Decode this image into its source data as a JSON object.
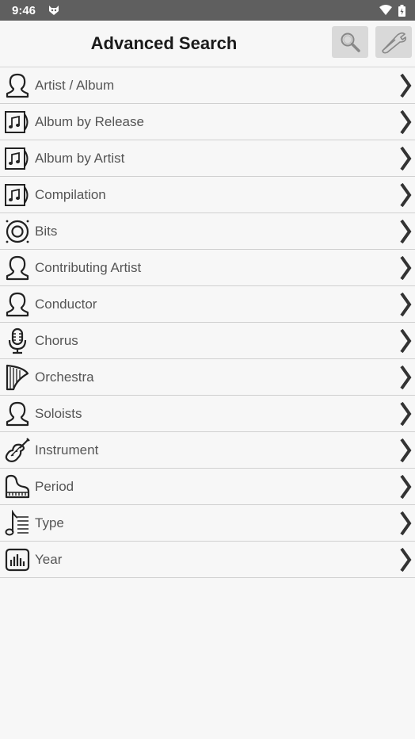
{
  "status": {
    "time": "9:46"
  },
  "header": {
    "title": "Advanced Search"
  },
  "toolbar": {
    "search_icon": "search-icon",
    "settings_icon": "wrench-icon"
  },
  "items": [
    {
      "label": "Artist / Album",
      "icon": "person-icon"
    },
    {
      "label": "Album by Release",
      "icon": "album-icon"
    },
    {
      "label": "Album by Artist",
      "icon": "album-icon"
    },
    {
      "label": "Compilation",
      "icon": "album-icon"
    },
    {
      "label": "Bits",
      "icon": "speaker-icon"
    },
    {
      "label": "Contributing Artist",
      "icon": "person-icon"
    },
    {
      "label": "Conductor",
      "icon": "person-icon"
    },
    {
      "label": "Chorus",
      "icon": "microphone-icon"
    },
    {
      "label": "Orchestra",
      "icon": "harp-icon"
    },
    {
      "label": "Soloists",
      "icon": "person-icon"
    },
    {
      "label": "Instrument",
      "icon": "violin-icon"
    },
    {
      "label": "Period",
      "icon": "piano-icon"
    },
    {
      "label": "Type",
      "icon": "note-list-icon"
    },
    {
      "label": "Year",
      "icon": "bar-chart-icon"
    }
  ]
}
